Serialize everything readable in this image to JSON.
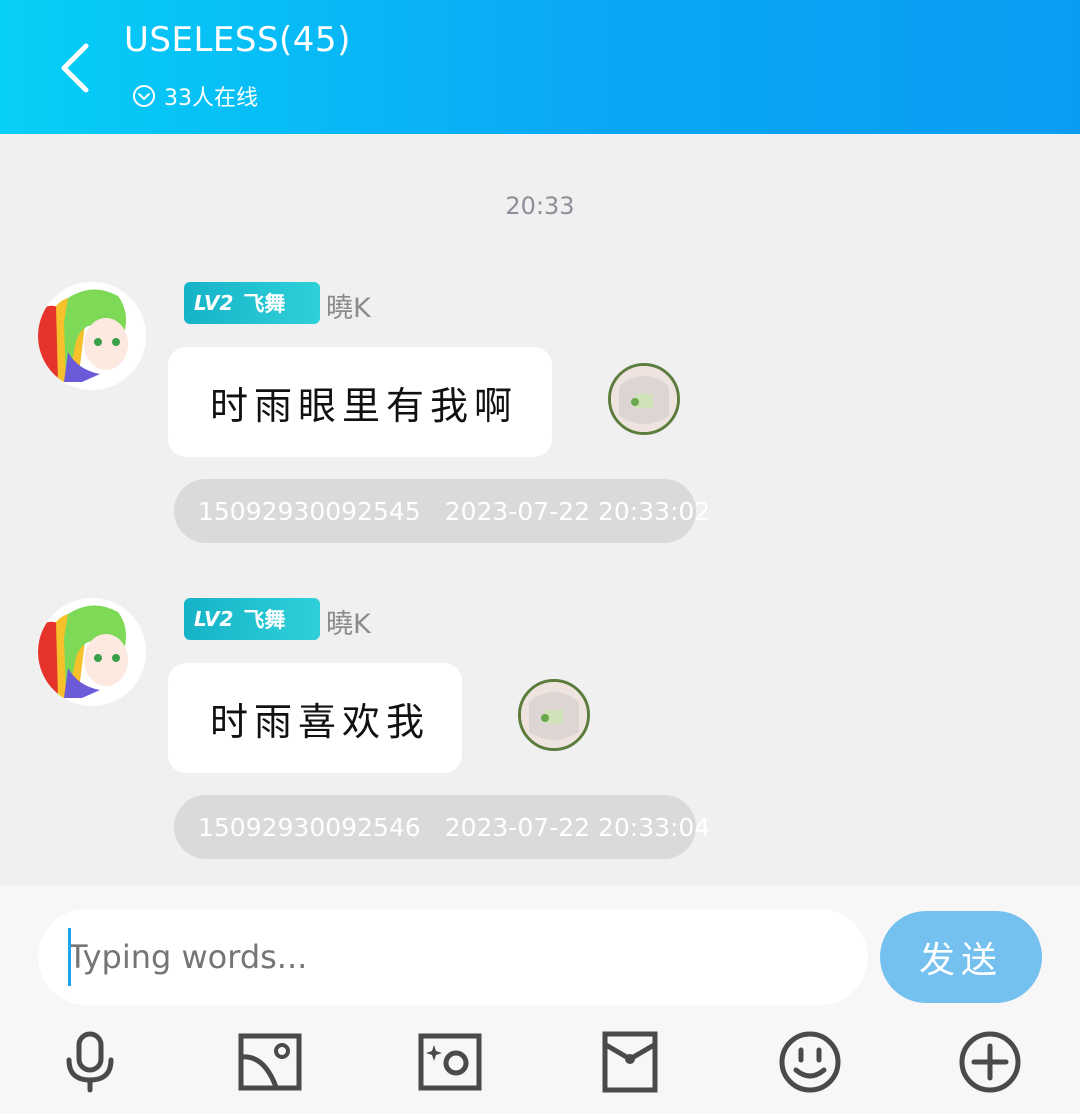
{
  "header": {
    "title": "USELESS(45)",
    "online_text": "33人在线"
  },
  "chat": {
    "timestamp": "20:33",
    "messages": [
      {
        "badge_level": "LV2",
        "badge_title": "飞舞",
        "nickname": "曉K",
        "text": "时雨眼里有我啊",
        "msg_id": "15092930092545",
        "datetime": "2023-07-22 20:33:02"
      },
      {
        "badge_level": "LV2",
        "badge_title": "飞舞",
        "nickname": "曉K",
        "text": "时雨喜欢我",
        "msg_id": "15092930092546",
        "datetime": "2023-07-22 20:33:04"
      }
    ]
  },
  "composer": {
    "placeholder": "Typing words...",
    "send_label": "发送"
  },
  "toolbar": {
    "icons": [
      "microphone-icon",
      "image-icon",
      "camera-icon",
      "red-packet-icon",
      "emoji-icon",
      "plus-icon"
    ]
  },
  "colors": {
    "header_start": "#06cff6",
    "header_end": "#0b9df2",
    "send_button": "#74c1ef",
    "badge": "#16b3c8"
  }
}
